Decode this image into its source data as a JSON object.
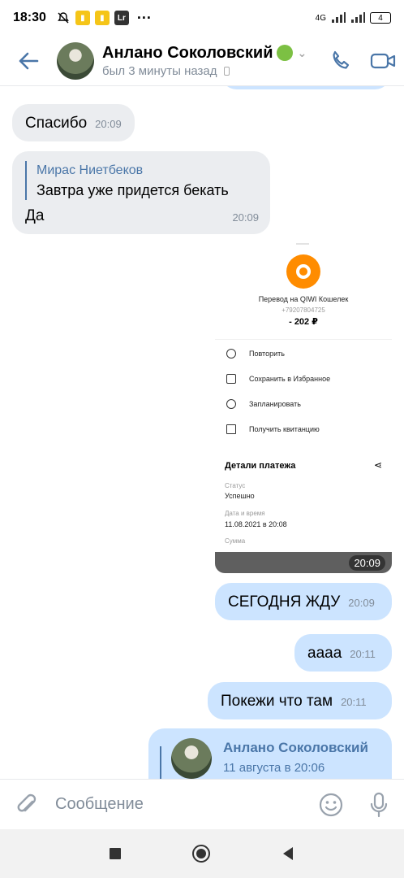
{
  "status_bar": {
    "time": "18:30",
    "signal_label": "4G",
    "battery": "4",
    "app_badge": "Lr"
  },
  "header": {
    "contact_name": "Анлано Соколовский",
    "last_seen": "был 3 минуты назад"
  },
  "messages": [
    {
      "direction": "in",
      "text": "Спасибо",
      "time": "20:09"
    },
    {
      "direction": "in",
      "reply_to_name": "Мирас Ниетбеков",
      "reply_to_text": "Завтра уже придется  бекать",
      "text": "Да",
      "time": "20:09"
    },
    {
      "direction": "out",
      "type": "image",
      "time": "20:09"
    },
    {
      "direction": "out",
      "text": "СЕГОДНЯ ЖДУ",
      "time": "20:09"
    },
    {
      "direction": "out",
      "text": "аааа",
      "time": "20:11"
    },
    {
      "direction": "out",
      "text": "Покежи что там",
      "time": "20:11"
    },
    {
      "direction": "out",
      "type": "forward",
      "author": "Анлано Соколовский",
      "date": "11 августа в 20:06"
    }
  ],
  "screenshot": {
    "title": "Перевод на QIWI Кошелек",
    "phone": "+79207804725",
    "amount": "- 202 ₽",
    "actions": [
      "Повторить",
      "Сохранить в Избранное",
      "Запланировать",
      "Получить квитанцию"
    ],
    "details_title": "Детали платежа",
    "status_label": "Статус",
    "status_value": "Успешно",
    "date_label": "Дата и время",
    "date_value": "11.08.2021 в 20:08",
    "sum_label": "Сумма"
  },
  "composer": {
    "placeholder": "Сообщение"
  },
  "colors": {
    "accent": "#4a76a8",
    "incoming_bubble": "#ebedf0",
    "outgoing_bubble": "#cce4ff"
  }
}
